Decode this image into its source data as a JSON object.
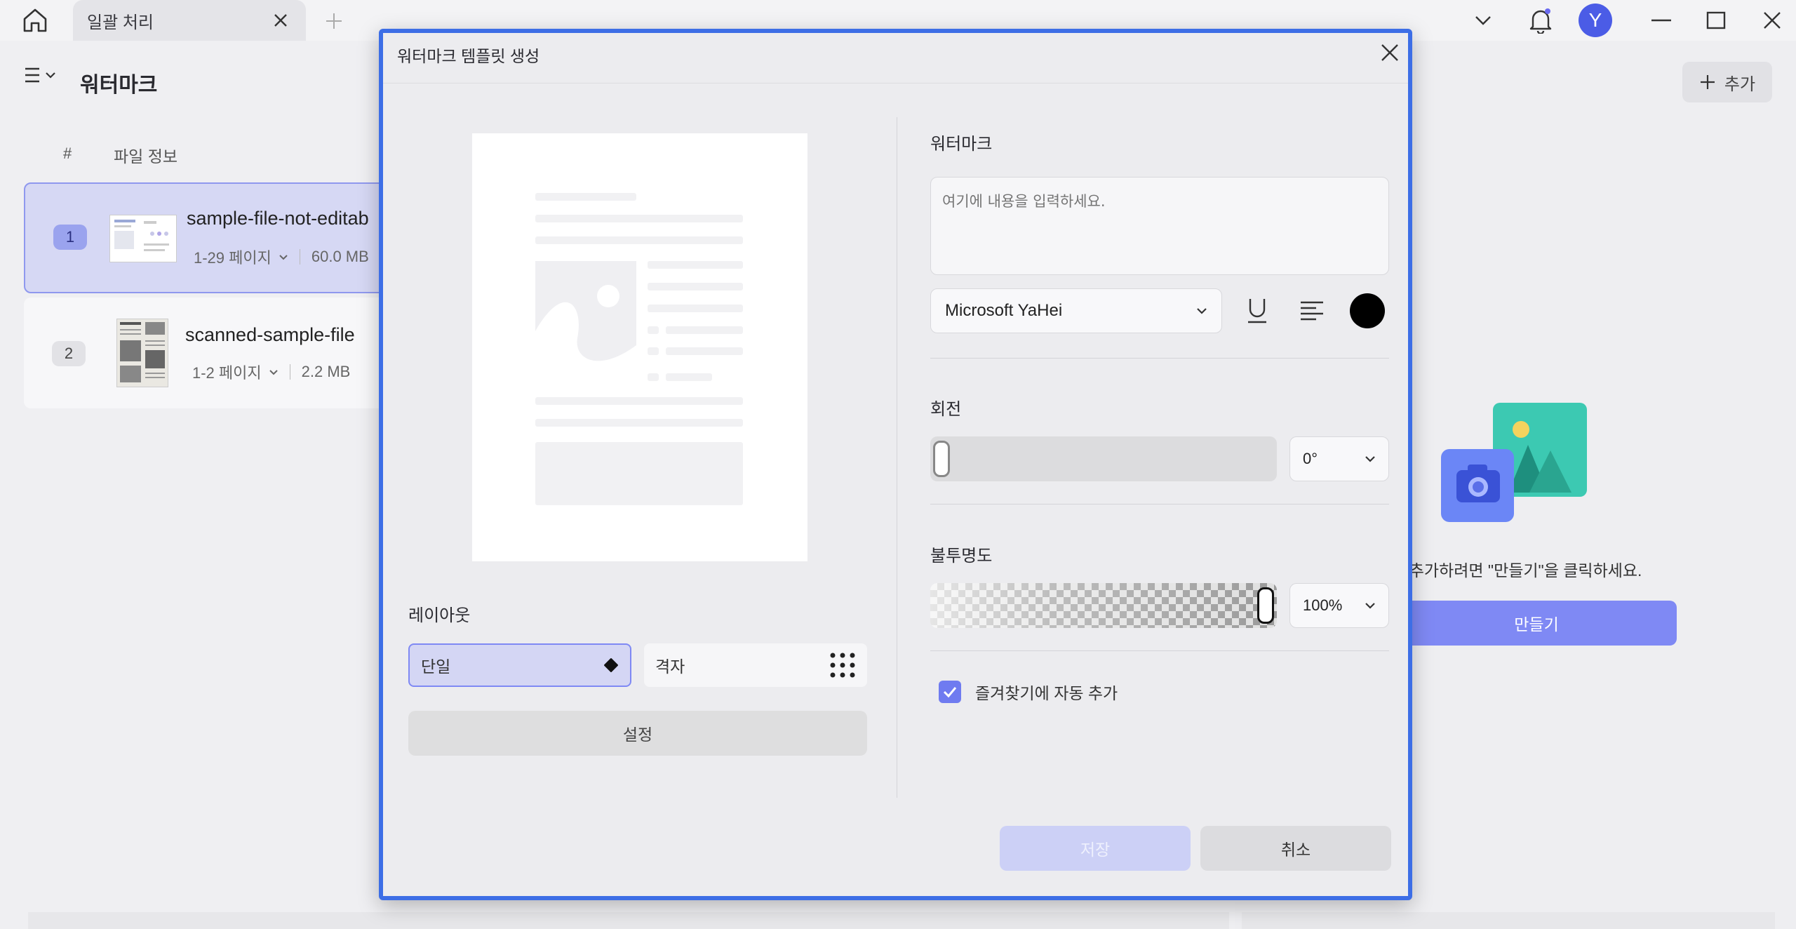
{
  "tab": {
    "label": "일괄 처리"
  },
  "user": {
    "avatar_letter": "Y"
  },
  "page": {
    "title": "워터마크"
  },
  "file_list": {
    "columns": [
      "#",
      "파일 정보"
    ],
    "rows": [
      {
        "num": "1",
        "name": "sample-file-not-editab",
        "pages": "1-29 페이지",
        "size": "60.0 MB"
      },
      {
        "num": "2",
        "name": "scanned-sample-file",
        "pages": "1-2 페이지",
        "size": "2.2 MB"
      }
    ]
  },
  "right": {
    "add_label": "추가",
    "hint": "크를 추가하려면 \"만들기\"을 클릭하세요.",
    "create_label": "만들기"
  },
  "modal": {
    "title": "워터마크 템플릿 생성",
    "layout_label": "레이아웃",
    "layout_options": [
      "단일",
      "격자"
    ],
    "settings_label": "설정",
    "watermark_label": "워터마크",
    "watermark_placeholder": "여기에 내용을 입력하세요.",
    "font": "Microsoft YaHei",
    "rotation_label": "회전",
    "rotation_value": "0°",
    "rotation_level": 0,
    "opacity_label": "불투명도",
    "opacity_value": "100%",
    "opacity_level": 1.0,
    "favorite_label": "즐겨찾기에 자동 추가",
    "favorite_checked": true,
    "save_label": "저장",
    "cancel_label": "취소"
  },
  "colors": {
    "accent": "#7f89f4",
    "modal_border": "#3d6ee6",
    "avatar": "#4b5ce6",
    "watermark_color": "#000000"
  },
  "icons": [
    "home-icon",
    "close-icon",
    "plus-icon",
    "chevron-down-icon",
    "bell-icon",
    "minimize-icon",
    "maximize-icon",
    "menu-icon",
    "underline-icon",
    "align-left-icon",
    "diamond-icon",
    "grid-dots-icon",
    "check-icon",
    "image-illustration"
  ]
}
